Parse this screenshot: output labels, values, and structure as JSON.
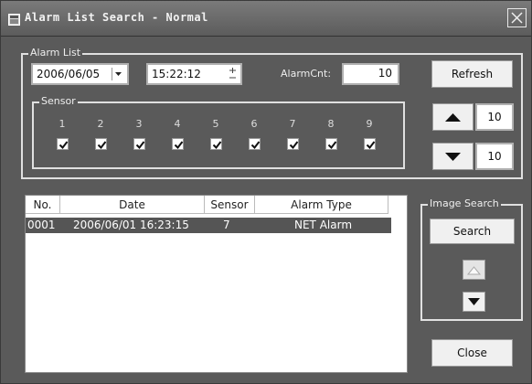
{
  "window": {
    "title": "Alarm List Search - Normal",
    "icons": {
      "window": "window-icon",
      "close": "close-icon"
    }
  },
  "alarm_list": {
    "legend": "Alarm List",
    "date": "2006/06/05",
    "time": "15:22:12",
    "alarm_cnt_label": "AlarmCnt:",
    "alarm_cnt_value": "10"
  },
  "sensor": {
    "legend": "Sensor",
    "items": [
      {
        "label": "1",
        "checked": true
      },
      {
        "label": "2",
        "checked": true
      },
      {
        "label": "3",
        "checked": true
      },
      {
        "label": "4",
        "checked": true
      },
      {
        "label": "5",
        "checked": true
      },
      {
        "label": "6",
        "checked": true
      },
      {
        "label": "7",
        "checked": true
      },
      {
        "label": "8",
        "checked": true
      },
      {
        "label": "9",
        "checked": true
      }
    ]
  },
  "controls": {
    "refresh_label": "Refresh",
    "up_count": "10",
    "down_count": "10"
  },
  "table": {
    "columns": [
      "No.",
      "Date",
      "Sensor",
      "Alarm Type"
    ],
    "rows": [
      {
        "no": "0001",
        "date": "2006/06/01 16:23:15",
        "sensor": "7",
        "type": "NET Alarm",
        "selected": true
      }
    ]
  },
  "image_search": {
    "legend": "Image Search",
    "search_label": "Search"
  },
  "close_label": "Close",
  "colors": {
    "window_bg": "#5a5a5a",
    "selected_row": "#555555"
  }
}
